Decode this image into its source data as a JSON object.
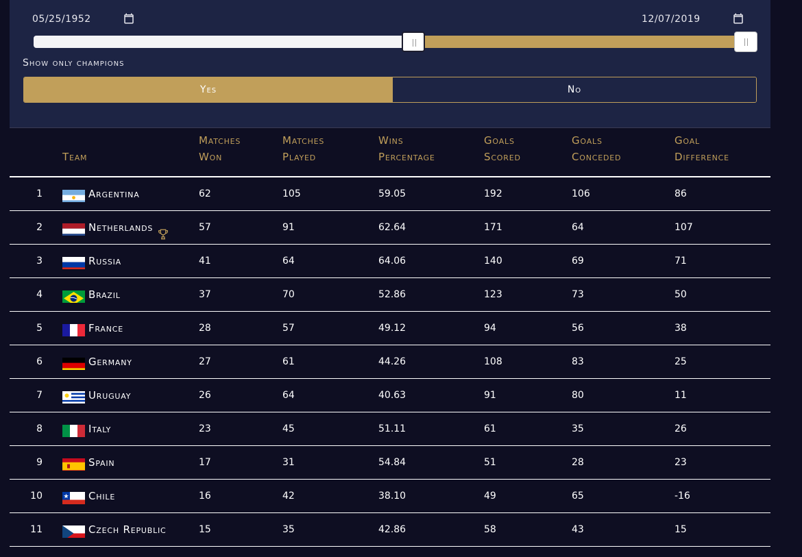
{
  "filters": {
    "date_start": "05/25/1952",
    "date_end": "12/07/2019",
    "calendar_icon": "calendar-icon",
    "range_color": "#c19f5a",
    "range_start_fraction": 0.525,
    "range_end_fraction": 0.985,
    "champions_label": "Show only champions",
    "option_yes": "Yes",
    "option_no": "No",
    "selected": "Yes"
  },
  "table": {
    "headers": {
      "team": "Team",
      "won_1": "Matches",
      "won_2": "Won",
      "played_1": "Matches",
      "played_2": "Played",
      "pct_1": "Wins",
      "pct_2": "Percentage",
      "scored_1": "Goals",
      "scored_2": "Scored",
      "conceded_1": "Goals",
      "conceded_2": "Conceded",
      "diff_1": "Goal",
      "diff_2": "Difference"
    },
    "rows": [
      {
        "rank": "1",
        "flag": "argentina-flag-icon",
        "team": "Argentina",
        "won": "62",
        "played": "105",
        "pct": "59.05",
        "scored": "192",
        "conceded": "106",
        "diff": "86"
      },
      {
        "rank": "2",
        "flag": "netherlands-flag-icon",
        "team": "Netherlands",
        "won": "57",
        "played": "91",
        "pct": "62.64",
        "scored": "171",
        "conceded": "64",
        "diff": "107",
        "trophy": "trophy-icon"
      },
      {
        "rank": "3",
        "flag": "russia-flag-icon",
        "team": "Russia",
        "won": "41",
        "played": "64",
        "pct": "64.06",
        "scored": "140",
        "conceded": "69",
        "diff": "71"
      },
      {
        "rank": "4",
        "flag": "brazil-flag-icon",
        "team": "Brazil",
        "won": "37",
        "played": "70",
        "pct": "52.86",
        "scored": "123",
        "conceded": "73",
        "diff": "50"
      },
      {
        "rank": "5",
        "flag": "france-flag-icon",
        "team": "France",
        "won": "28",
        "played": "57",
        "pct": "49.12",
        "scored": "94",
        "conceded": "56",
        "diff": "38"
      },
      {
        "rank": "6",
        "flag": "germany-flag-icon",
        "team": "Germany",
        "won": "27",
        "played": "61",
        "pct": "44.26",
        "scored": "108",
        "conceded": "83",
        "diff": "25"
      },
      {
        "rank": "7",
        "flag": "uruguay-flag-icon",
        "team": "Uruguay",
        "won": "26",
        "played": "64",
        "pct": "40.63",
        "scored": "91",
        "conceded": "80",
        "diff": "11"
      },
      {
        "rank": "8",
        "flag": "italy-flag-icon",
        "team": "Italy",
        "won": "23",
        "played": "45",
        "pct": "51.11",
        "scored": "61",
        "conceded": "35",
        "diff": "26"
      },
      {
        "rank": "9",
        "flag": "spain-flag-icon",
        "team": "Spain",
        "won": "17",
        "played": "31",
        "pct": "54.84",
        "scored": "51",
        "conceded": "28",
        "diff": "23"
      },
      {
        "rank": "10",
        "flag": "chile-flag-icon",
        "team": "Chile",
        "won": "16",
        "played": "42",
        "pct": "38.10",
        "scored": "49",
        "conceded": "65",
        "diff": "-16"
      },
      {
        "rank": "11",
        "flag": "czech-republic-flag-icon",
        "team": "Czech Republic",
        "won": "15",
        "played": "35",
        "pct": "42.86",
        "scored": "58",
        "conceded": "43",
        "diff": "15"
      }
    ]
  }
}
